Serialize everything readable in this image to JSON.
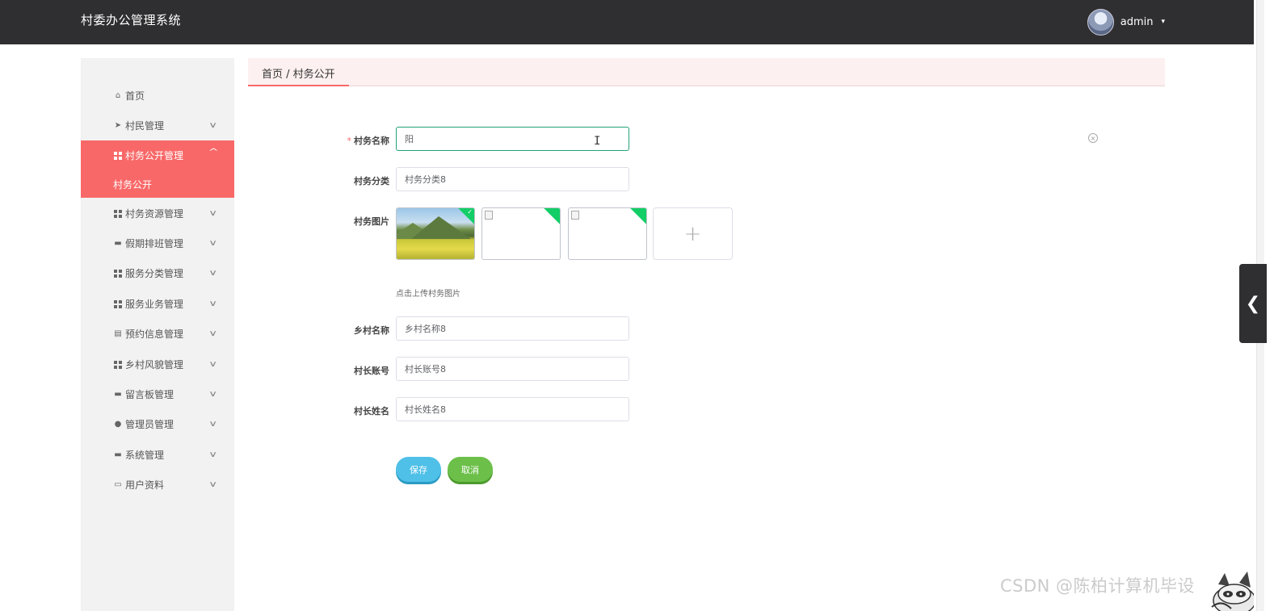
{
  "header": {
    "app_title": "村委办公管理系统",
    "username": "admin",
    "caret": "▾"
  },
  "sidebar": {
    "items": [
      {
        "label": "首页",
        "icon": "home-icon",
        "glyph": "⌂",
        "chevron": false
      },
      {
        "label": "村民管理",
        "icon": "send-icon",
        "glyph": "➤",
        "chevron": true
      },
      {
        "label": "村务公开管理",
        "icon": "grid-icon",
        "glyph": "",
        "chevron": true,
        "active": true,
        "chevron_glyph": "^"
      },
      {
        "label": "村务资源管理",
        "icon": "grid-icon",
        "glyph": "",
        "chevron": true
      },
      {
        "label": "假期排班管理",
        "icon": "comment-icon",
        "glyph": "▬",
        "chevron": true
      },
      {
        "label": "服务分类管理",
        "icon": "grid-icon",
        "glyph": "",
        "chevron": true
      },
      {
        "label": "服务业务管理",
        "icon": "grid-icon",
        "glyph": "",
        "chevron": true
      },
      {
        "label": "预约信息管理",
        "icon": "clipboard-icon",
        "glyph": "▤",
        "chevron": true
      },
      {
        "label": "乡村风貌管理",
        "icon": "grid-icon",
        "glyph": "",
        "chevron": true
      },
      {
        "label": "留言板管理",
        "icon": "message-icon",
        "glyph": "▬",
        "chevron": true
      },
      {
        "label": "管理员管理",
        "icon": "bulb-icon",
        "glyph": "●",
        "chevron": true
      },
      {
        "label": "系统管理",
        "icon": "monitor-icon",
        "glyph": "▬",
        "chevron": true
      },
      {
        "label": "用户资料",
        "icon": "card-icon",
        "glyph": "▭",
        "chevron": true
      }
    ],
    "sub_item": "村务公开",
    "chevron_glyph": "∨"
  },
  "breadcrumb": {
    "text": "首页 / 村务公开"
  },
  "form": {
    "required_mark": "*",
    "name_label": "村务名称",
    "name_value": "阳",
    "category_label": "村务分类",
    "category_value": "村务分类8",
    "images_label": "村务图片",
    "upload_plus": "+",
    "upload_hint": "点击上传村务图片",
    "village_label": "乡村名称",
    "village_value": "乡村名称8",
    "chief_account_label": "村长账号",
    "chief_account_value": "村长账号8",
    "chief_name_label": "村长姓名",
    "chief_name_value": "村长姓名8",
    "save_label": "保存",
    "cancel_label": "取消",
    "clear_glyph": "×",
    "cursor_glyph": "I",
    "check_glyph": "✓"
  },
  "side_tab": {
    "glyph": "❮"
  },
  "watermark": "CSDN @陈柏计算机毕设",
  "colors": {
    "header_bg": "#2f2f31",
    "accent": "#f96868",
    "save_btn": "#4fc0e8",
    "cancel_btn": "#6cc04a",
    "focus_border": "#24a178",
    "upload_success": "#13ce66"
  }
}
